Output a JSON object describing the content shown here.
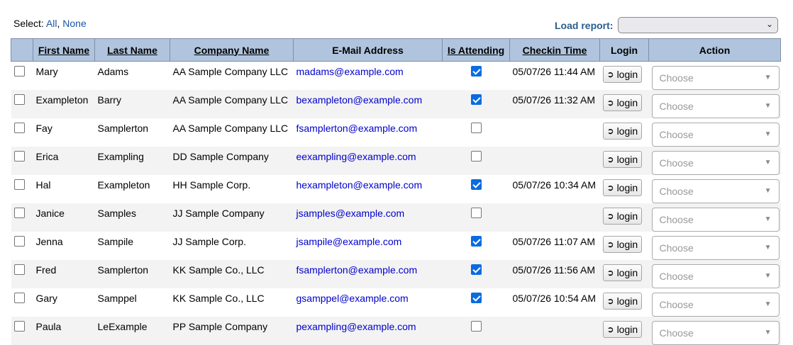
{
  "top": {
    "select_prefix": "Select:",
    "select_all": "All",
    "select_sep": ",",
    "select_none": "None",
    "load_report_label": "Load report:",
    "load_report_value": ""
  },
  "columns": {
    "first_name": "First Name",
    "last_name": "Last Name",
    "company": "Company Name",
    "email": "E-Mail Address",
    "attending": "Is Attending",
    "checkin": "Checkin Time",
    "login": "Login",
    "action": "Action"
  },
  "login_label": "login",
  "action_placeholder": "Choose",
  "rows": [
    {
      "first": "Mary",
      "last": "Adams",
      "company": "AA Sample Company LLC",
      "email": "madams@example.com",
      "attending": true,
      "checkin": "05/07/26 11:44 AM"
    },
    {
      "first": "Exampleton",
      "last": "Barry",
      "company": "AA Sample Company LLC",
      "email": "bexampleton@example.com",
      "attending": true,
      "checkin": "05/07/26 11:32 AM"
    },
    {
      "first": "Fay",
      "last": "Samplerton",
      "company": "AA Sample Company LLC",
      "email": "fsamplerton@example.com",
      "attending": false,
      "checkin": ""
    },
    {
      "first": "Erica",
      "last": "Exampling",
      "company": "DD Sample Company",
      "email": "eexampling@example.com",
      "attending": false,
      "checkin": ""
    },
    {
      "first": "Hal",
      "last": "Exampleton",
      "company": "HH Sample Corp.",
      "email": "hexampleton@example.com",
      "attending": true,
      "checkin": "05/07/26 10:34 AM"
    },
    {
      "first": "Janice",
      "last": "Samples",
      "company": "JJ Sample Company",
      "email": "jsamples@example.com",
      "attending": false,
      "checkin": ""
    },
    {
      "first": "Jenna",
      "last": "Sampile",
      "company": "JJ Sample Corp.",
      "email": "jsampile@example.com",
      "attending": true,
      "checkin": "05/07/26 11:07 AM"
    },
    {
      "first": "Fred",
      "last": "Samplerton",
      "company": "KK Sample Co., LLC",
      "email": "fsamplerton@example.com",
      "attending": true,
      "checkin": "05/07/26 11:56 AM"
    },
    {
      "first": "Gary",
      "last": "Samppel",
      "company": "KK Sample Co., LLC",
      "email": "gsamppel@example.com",
      "attending": true,
      "checkin": "05/07/26 10:54 AM"
    },
    {
      "first": "Paula",
      "last": "LeExample",
      "company": "PP Sample Company",
      "email": "pexampling@example.com",
      "attending": false,
      "checkin": ""
    }
  ]
}
